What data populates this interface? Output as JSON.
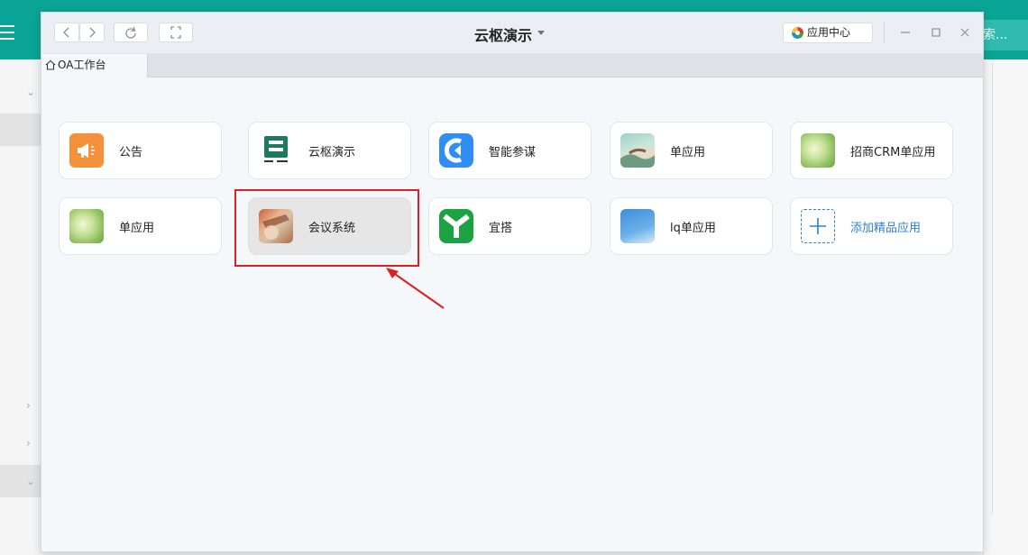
{
  "background": {
    "search_text": "索..."
  },
  "window": {
    "title": "云枢演示",
    "app_center_label": "应用中心",
    "tab_label": "OA工作台"
  },
  "apps": [
    {
      "label": "公告",
      "icon": "announcement-icon"
    },
    {
      "label": "云枢演示",
      "icon": "yunshu-logo-icon"
    },
    {
      "label": "智能参谋",
      "icon": "smart-advisor-icon"
    },
    {
      "label": "单应用",
      "icon": "landscape-photo-icon"
    },
    {
      "label": "招商CRM单应用",
      "icon": "leaf-photo-icon"
    },
    {
      "label": "单应用",
      "icon": "leaf-photo-icon"
    },
    {
      "label": "会议系统",
      "icon": "meeting-photo-icon",
      "selected": true
    },
    {
      "label": "宜搭",
      "icon": "yida-logo-icon"
    },
    {
      "label": "lq单应用",
      "icon": "sky-photo-icon"
    },
    {
      "label": "添加精品应用",
      "icon": "plus-icon"
    }
  ],
  "colors": {
    "topbar": "#0aa596",
    "highlight": "#e02020",
    "link": "#2f7fd8"
  }
}
